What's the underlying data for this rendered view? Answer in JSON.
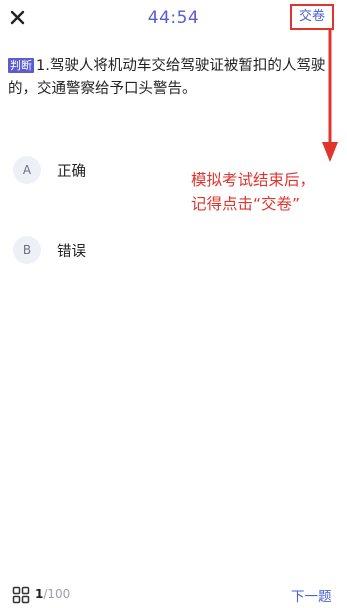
{
  "header": {
    "timer": "44:54",
    "submit_label": "交卷"
  },
  "question": {
    "tag": "判断",
    "text": "1.驾驶人将机动车交给驾驶证被暂扣的人驾驶的，交通警察给予口头警告。"
  },
  "options": [
    {
      "letter": "A",
      "label": "正确"
    },
    {
      "letter": "B",
      "label": "错误"
    }
  ],
  "annotation": {
    "line1": "模拟考试结束后，",
    "line2": "记得点击“交卷”",
    "color": "#e0342d"
  },
  "footer": {
    "current": "1",
    "total": "/100",
    "next_label": "下一题"
  },
  "colors": {
    "accent": "#4a63d2",
    "timer": "#5b5bd6",
    "tag_bg": "#5c5ccf",
    "highlight": "#e0342d"
  },
  "icons": {
    "close": "close-icon",
    "grid": "grid-icon",
    "arrow": "arrow-down-icon"
  }
}
